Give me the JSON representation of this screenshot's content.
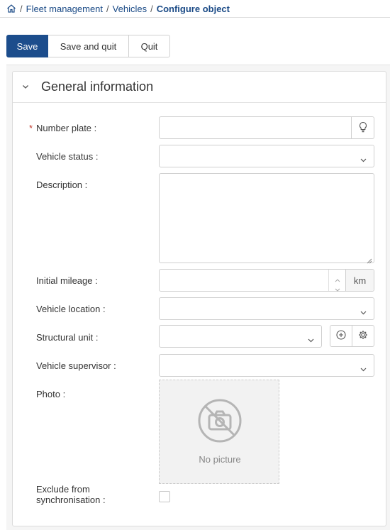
{
  "breadcrumb": {
    "home_icon": "home-icon",
    "items": [
      "Fleet management",
      "Vehicles"
    ],
    "separator": "/",
    "current": "Configure object"
  },
  "toolbar": {
    "save": "Save",
    "save_and_quit": "Save and quit",
    "quit": "Quit"
  },
  "panel": {
    "title": "General information",
    "collapse_icon": "chevron-down-icon"
  },
  "form": {
    "required_marker": "*",
    "number_plate": {
      "label": "Number plate :",
      "value": ""
    },
    "vehicle_status": {
      "label": "Vehicle status :",
      "value": ""
    },
    "description": {
      "label": "Description :",
      "value": ""
    },
    "initial_mileage": {
      "label": "Initial mileage :",
      "value": "",
      "unit": "km"
    },
    "vehicle_location": {
      "label": "Vehicle location :",
      "value": ""
    },
    "structural_unit": {
      "label": "Structural unit :",
      "value": ""
    },
    "vehicle_supervisor": {
      "label": "Vehicle supervisor :",
      "value": ""
    },
    "photo": {
      "label": "Photo :",
      "placeholder_text": "No picture"
    },
    "exclude_sync": {
      "label_line1": "Exclude from",
      "label_line2": "synchronisation :",
      "checked": false
    }
  },
  "colors": {
    "primary": "#1c4d8c",
    "link": "#1a4a86",
    "required": "#c0392b"
  }
}
